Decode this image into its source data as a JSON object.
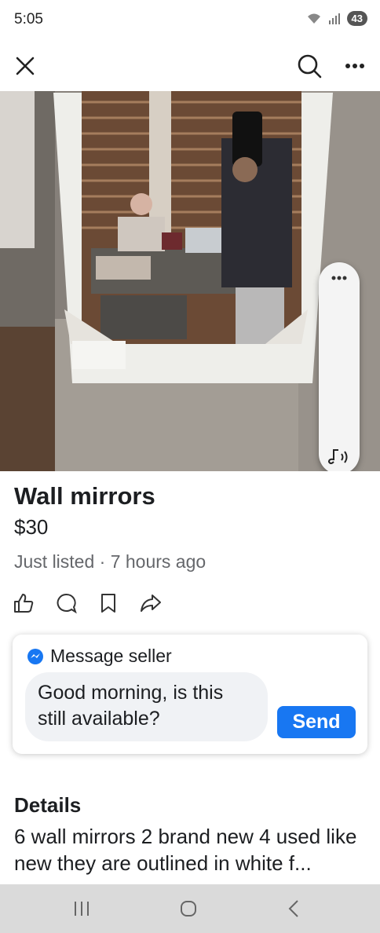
{
  "status": {
    "time": "5:05",
    "battery": "43"
  },
  "topbar": {
    "close_icon": "close-icon",
    "search_icon": "search-icon",
    "more_icon": "more-icon"
  },
  "listing": {
    "title": "Wall mirrors",
    "price": "$30",
    "subline": "Just listed · 7 hours ago"
  },
  "photo": {
    "handle_icon": "more-dots-icon",
    "sound_icon": "sound-icon"
  },
  "actions": [
    "like-icon",
    "comment-icon",
    "save-icon",
    "share-icon"
  ],
  "message": {
    "header": "Message seller",
    "draft": "Good morning, is this still available?",
    "send_label": "Send"
  },
  "details": {
    "heading": "Details",
    "text": "6 wall mirrors 2 brand new 4 used like new they are outlined in white f..."
  },
  "navbar": [
    "recents-icon",
    "home-icon",
    "back-icon"
  ],
  "colors": {
    "accent": "#1877f2",
    "muted": "#65676b"
  }
}
